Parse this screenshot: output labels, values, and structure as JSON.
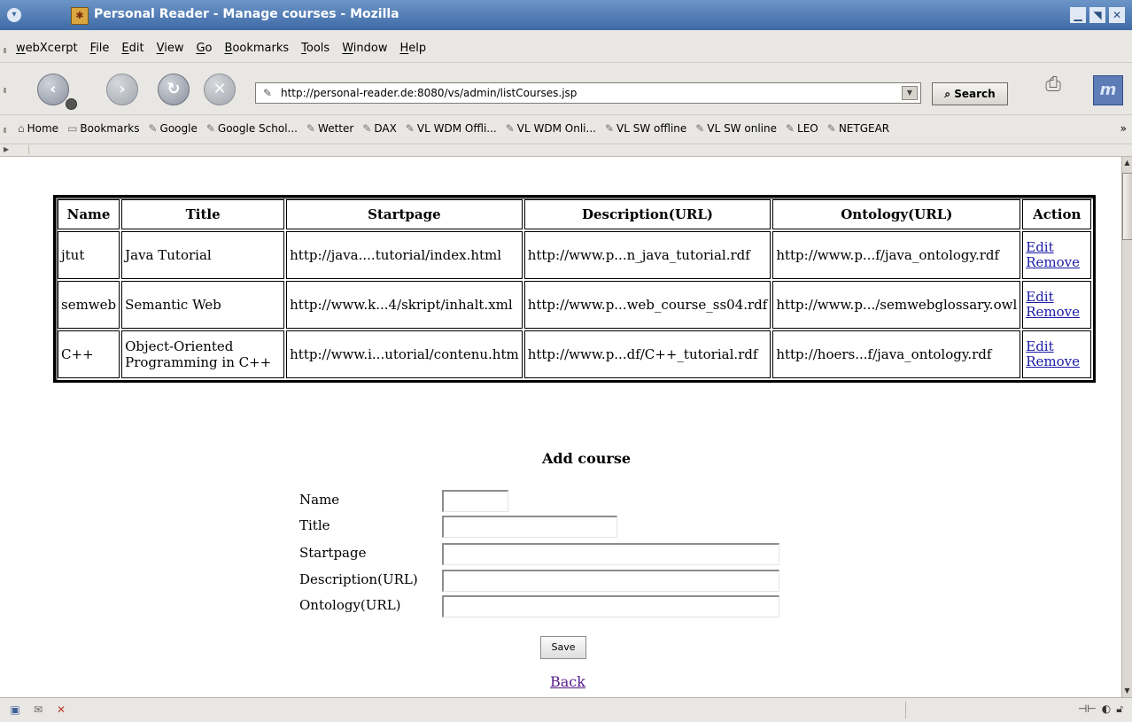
{
  "window": {
    "title": "Personal Reader - Manage courses - Mozilla"
  },
  "menubar": {
    "items": [
      "webXcerpt",
      "File",
      "Edit",
      "View",
      "Go",
      "Bookmarks",
      "Tools",
      "Window",
      "Help"
    ]
  },
  "navbar": {
    "url": "http://personal-reader.de:8080/vs/admin/listCourses.jsp",
    "search_label": "Search"
  },
  "bookmarks": {
    "items": [
      "Home",
      "Bookmarks",
      "Google",
      "Google Schol...",
      "Wetter",
      "DAX",
      "VL WDM Offli...",
      "VL WDM Onli...",
      "VL SW offline",
      "VL SW online",
      "LEO",
      "NETGEAR"
    ],
    "more": "»"
  },
  "courses_table": {
    "headers": [
      "Name",
      "Title",
      "Startpage",
      "Description(URL)",
      "Ontology(URL)",
      "Action"
    ],
    "rows": [
      {
        "name": "jtut",
        "title": "Java Tutorial",
        "startpage": "http://java....tutorial/index.html",
        "description": "http://www.p...n_java_tutorial.rdf",
        "ontology": "http://www.p...f/java_ontology.rdf",
        "edit": "Edit",
        "remove": "Remove"
      },
      {
        "name": "semweb",
        "title": "Semantic Web",
        "startpage": "http://www.k...4/skript/inhalt.xml",
        "description": "http://www.p...web_course_ss04.rdf",
        "ontology": "http://www.p.../semwebglossary.owl",
        "edit": "Edit",
        "remove": "Remove"
      },
      {
        "name": "C++",
        "title": "Object-Oriented Programming in C++",
        "title_line1": "Object-Oriented",
        "title_line2": "Programming in C++",
        "startpage": "http://www.i...utorial/contenu.htm",
        "description": "http://www.p...df/C++_tutorial.rdf",
        "ontology": "http://hoers...f/java_ontology.rdf",
        "edit": "Edit",
        "remove": "Remove"
      }
    ]
  },
  "add_course": {
    "title": "Add course",
    "fields": [
      {
        "label": "Name",
        "value": ""
      },
      {
        "label": "Title",
        "value": ""
      },
      {
        "label": "Startpage",
        "value": ""
      },
      {
        "label": "Description(URL)",
        "value": ""
      },
      {
        "label": "Ontology(URL)",
        "value": ""
      }
    ],
    "save_label": "Save",
    "back_label": "Back"
  }
}
